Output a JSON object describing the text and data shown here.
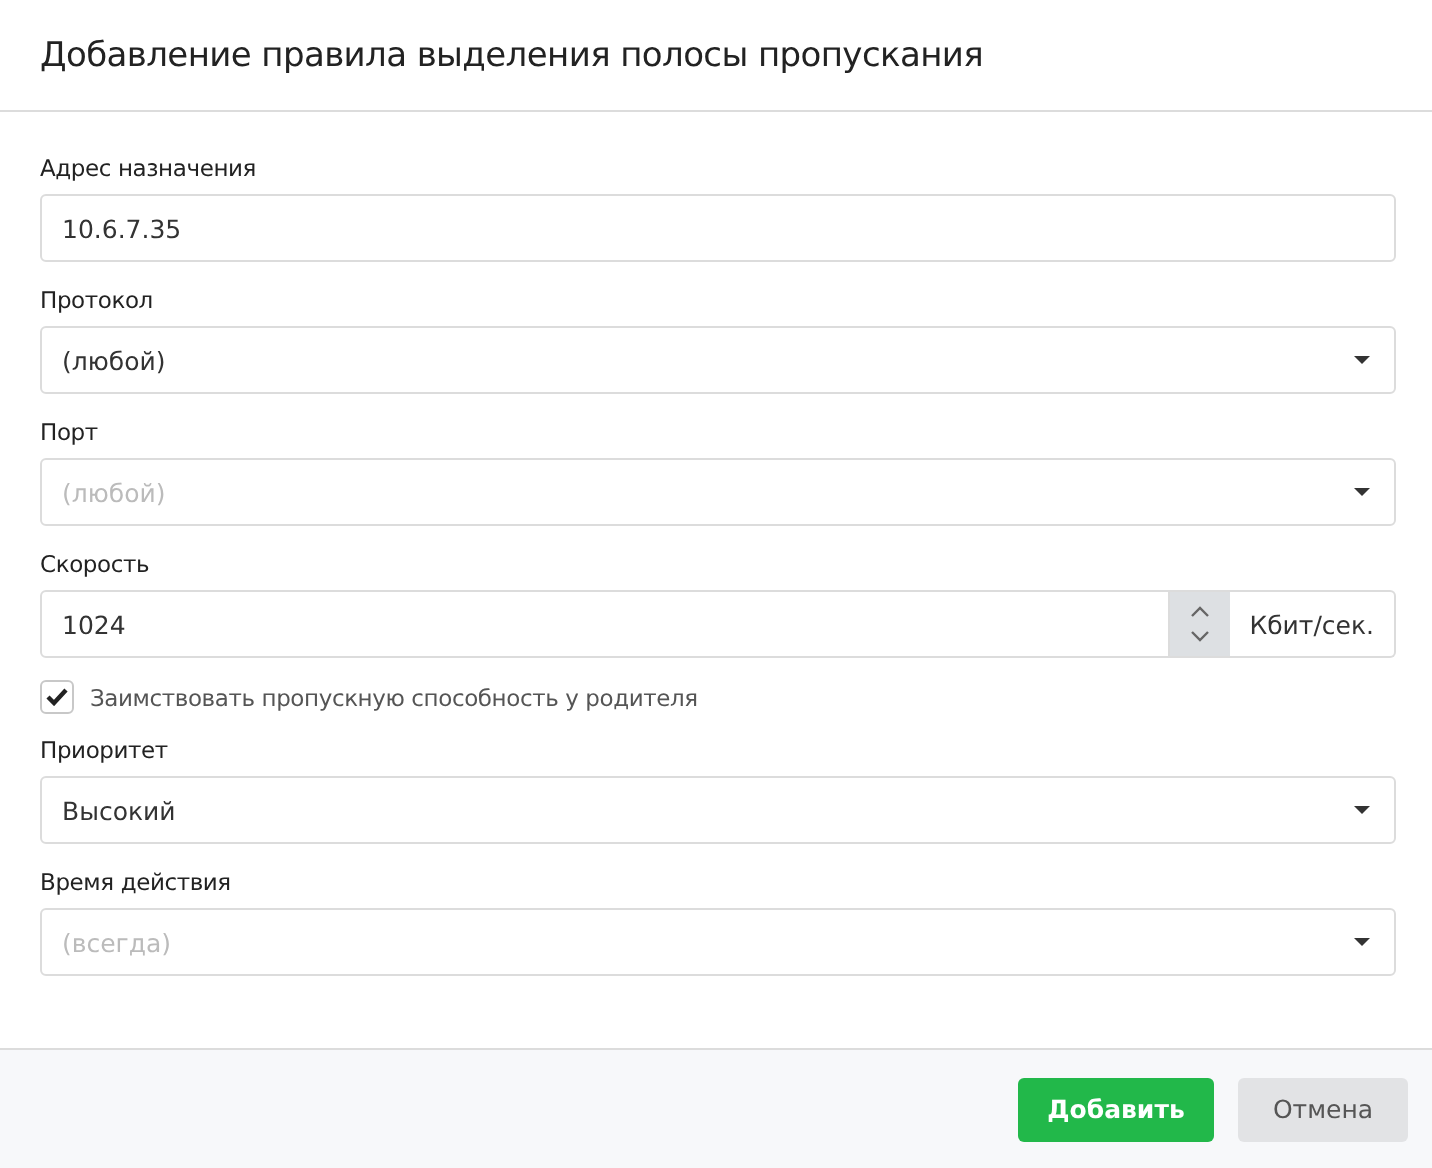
{
  "dialog": {
    "title": "Добавление правила выделения полосы пропускания"
  },
  "fields": [
    {
      "kind": "text",
      "label": "Адрес назначения",
      "value": "10.6.7.35"
    },
    {
      "kind": "select",
      "label": "Протокол",
      "value": "(любой)"
    },
    {
      "kind": "select",
      "label": "Порт",
      "placeholder": "(любой)"
    },
    {
      "kind": "number",
      "label": "Скорость",
      "value": "1024",
      "unit": "Кбит/сек."
    },
    {
      "kind": "checkbox",
      "label": "Заимствовать пропускную способность у родителя",
      "checked": true
    },
    {
      "kind": "select",
      "label": "Приоритет",
      "value": "Высокий"
    },
    {
      "kind": "select",
      "label": "Время действия",
      "placeholder": "(всегда)"
    }
  ],
  "buttons": [
    {
      "label": "Добавить",
      "kind": "primary"
    },
    {
      "label": "Отмена",
      "kind": "secondary"
    }
  ]
}
